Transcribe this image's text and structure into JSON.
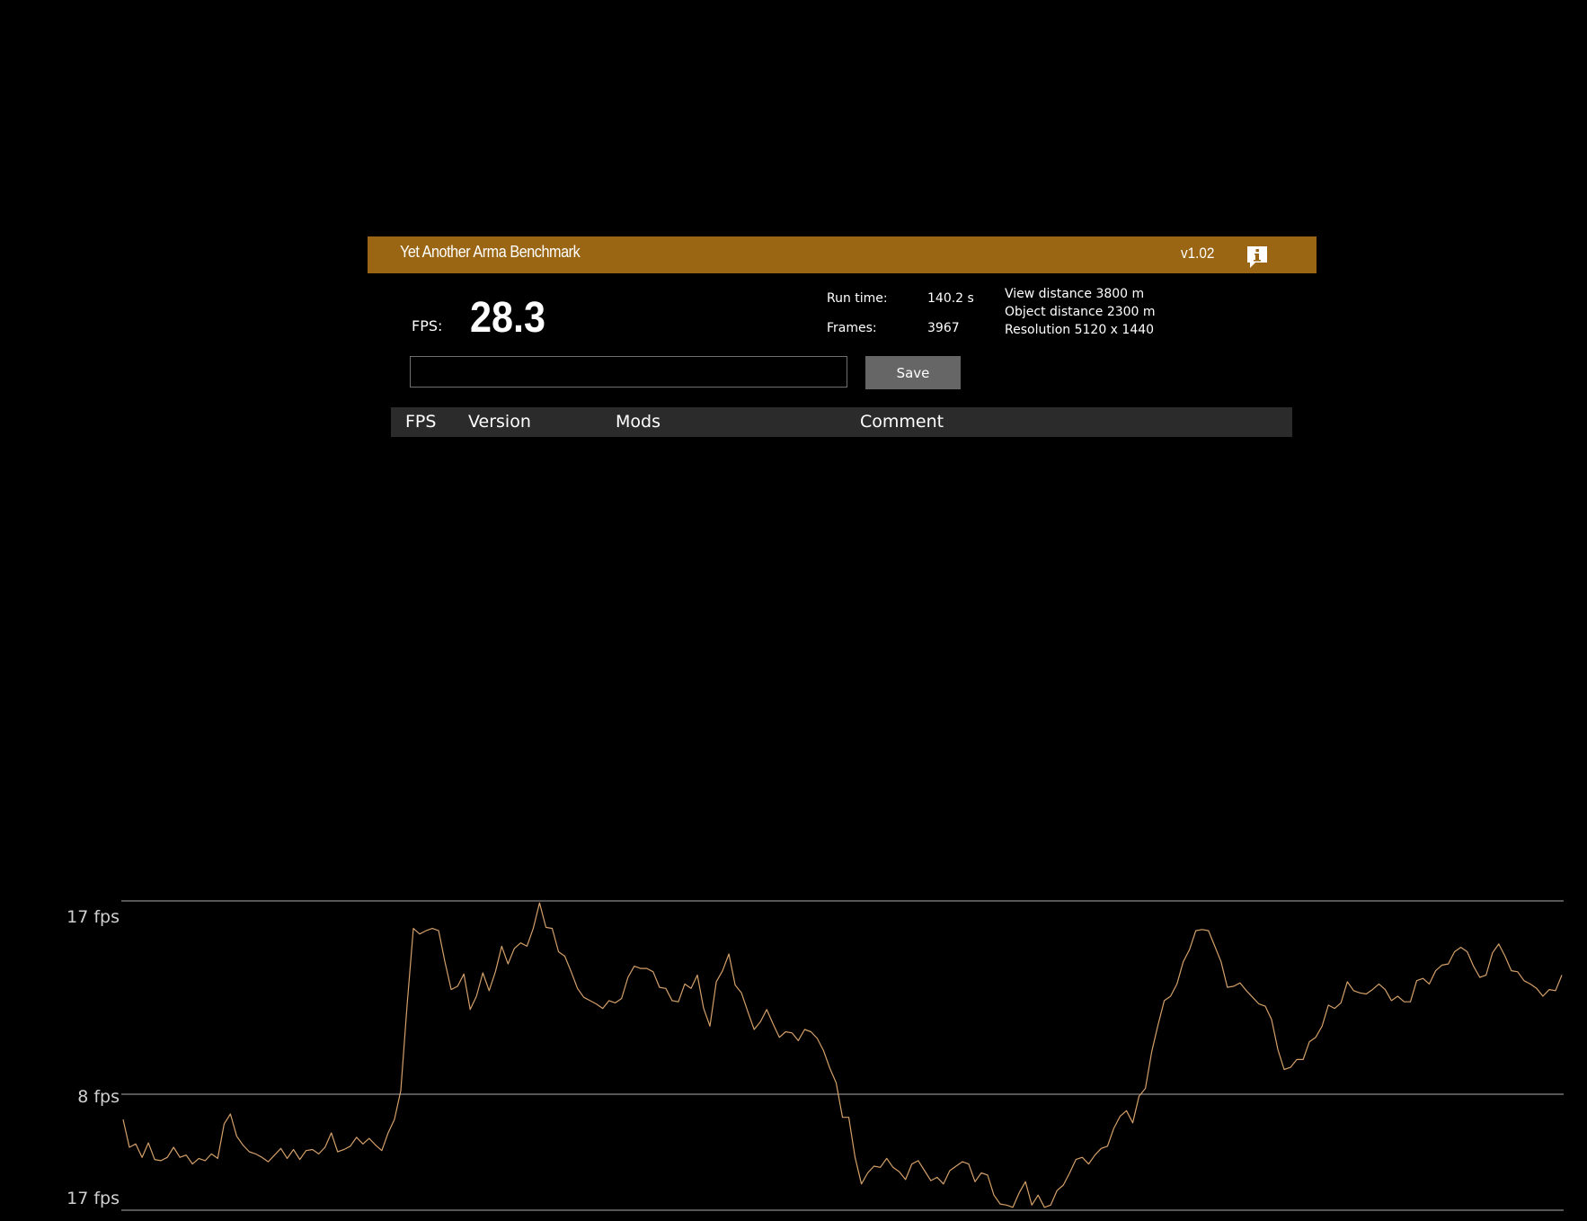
{
  "window": {
    "title": "Yet Another Arma Benchmark",
    "version": "v1.02",
    "info_icon": "info-speech-bubble-icon",
    "accent_color": "#9a6614"
  },
  "result": {
    "fps_label": "FPS:",
    "fps_value": "28.3",
    "run_time_label": "Run time:",
    "run_time_value": "140.2 s",
    "frames_label": "Frames:",
    "frames_value": "3967"
  },
  "settings": {
    "view_distance": "View distance 3800 m",
    "object_distance": "Object distance 2300 m",
    "resolution": "Resolution 5120 x 1440"
  },
  "comment": {
    "value": "",
    "placeholder": ""
  },
  "save_label": "Save",
  "table": {
    "columns": [
      "FPS",
      "Version",
      "Mods",
      "Comment"
    ],
    "rows": []
  },
  "chart_data": {
    "type": "line",
    "title": "",
    "xlabel": "",
    "ylabel": "",
    "y_tick_labels": [
      "17 fps",
      "8 fps",
      "17 fps"
    ],
    "line_color": "#d4a06a",
    "grid": true,
    "series": [
      {
        "values": [
          33.0,
          30.5,
          30.8,
          29.6,
          30.9,
          29.4,
          29.3,
          29.6,
          30.5,
          29.6,
          29.8,
          29.0,
          29.5,
          29.3,
          29.9,
          29.5,
          32.6,
          33.5,
          31.5,
          30.7,
          30.1,
          29.9,
          29.6,
          29.2,
          29.8,
          30.4,
          29.5,
          30.3,
          29.4,
          30.2,
          30.3,
          29.9,
          30.5,
          31.8,
          30.1,
          30.3,
          30.6,
          31.4,
          30.8,
          31.3,
          30.7,
          30.2,
          31.8,
          33.0,
          35.6,
          43.3,
          50.2,
          49.7,
          50.0,
          50.2,
          50.0,
          47.2,
          44.7,
          45.0,
          46.1,
          42.9,
          44.1,
          46.2,
          44.6,
          46.3,
          48.6,
          47.0,
          48.4,
          48.9,
          48.6,
          50.2,
          52.5,
          50.3,
          50.2,
          48.1,
          47.7,
          46.3,
          44.8,
          44.0,
          43.7,
          43.4,
          43.0,
          43.7,
          43.5,
          43.9,
          45.8,
          46.8,
          46.6,
          46.6,
          46.3,
          44.9,
          44.8,
          43.7,
          43.6,
          45.2,
          44.8,
          46.0,
          43.0,
          41.4,
          45.4,
          46.4,
          47.9,
          45.1,
          44.4,
          42.7,
          41.1,
          41.8,
          42.9,
          41.6,
          40.4,
          40.9,
          40.8,
          40.1,
          41.1,
          40.9,
          40.3,
          39.2,
          37.6,
          36.3,
          33.2,
          33.2,
          29.6,
          27.2,
          28.2,
          28.8,
          28.7,
          29.5,
          28.7,
          28.3,
          27.6,
          29.0,
          29.3,
          28.4,
          27.5,
          27.8,
          27.2,
          28.4,
          28.8,
          29.2,
          29.0,
          27.4,
          28.2,
          28.0,
          26.2,
          25.4,
          25.3,
          25.1,
          26.4,
          27.4,
          25.3,
          26.2,
          25.1,
          25.3,
          26.6,
          27.1,
          28.2,
          29.4,
          29.6,
          29.0,
          29.8,
          30.4,
          30.6,
          32.2,
          33.3,
          33.8,
          32.7,
          35.1,
          35.8,
          39.1,
          41.5,
          43.7,
          44.1,
          45.2,
          47.2,
          48.3,
          50.0,
          50.1,
          50.0,
          48.6,
          47.2,
          44.9,
          45.0,
          45.3,
          44.6,
          44.0,
          43.4,
          43.2,
          42.0,
          39.3,
          37.5,
          37.7,
          38.4,
          38.4,
          40.0,
          40.4,
          41.4,
          43.3,
          43.0,
          43.5,
          45.4,
          44.6,
          44.4,
          44.3,
          44.7,
          45.2,
          44.7,
          43.7,
          44.1,
          43.6,
          43.6,
          45.5,
          45.7,
          45.2,
          46.4,
          46.9,
          47.0,
          48.1,
          48.5,
          48.1,
          46.8,
          45.8,
          46.0,
          48.0,
          48.8,
          47.7,
          46.4,
          46.3,
          45.5,
          45.2,
          44.8,
          44.1,
          44.7,
          44.6,
          46.0
        ]
      }
    ]
  }
}
